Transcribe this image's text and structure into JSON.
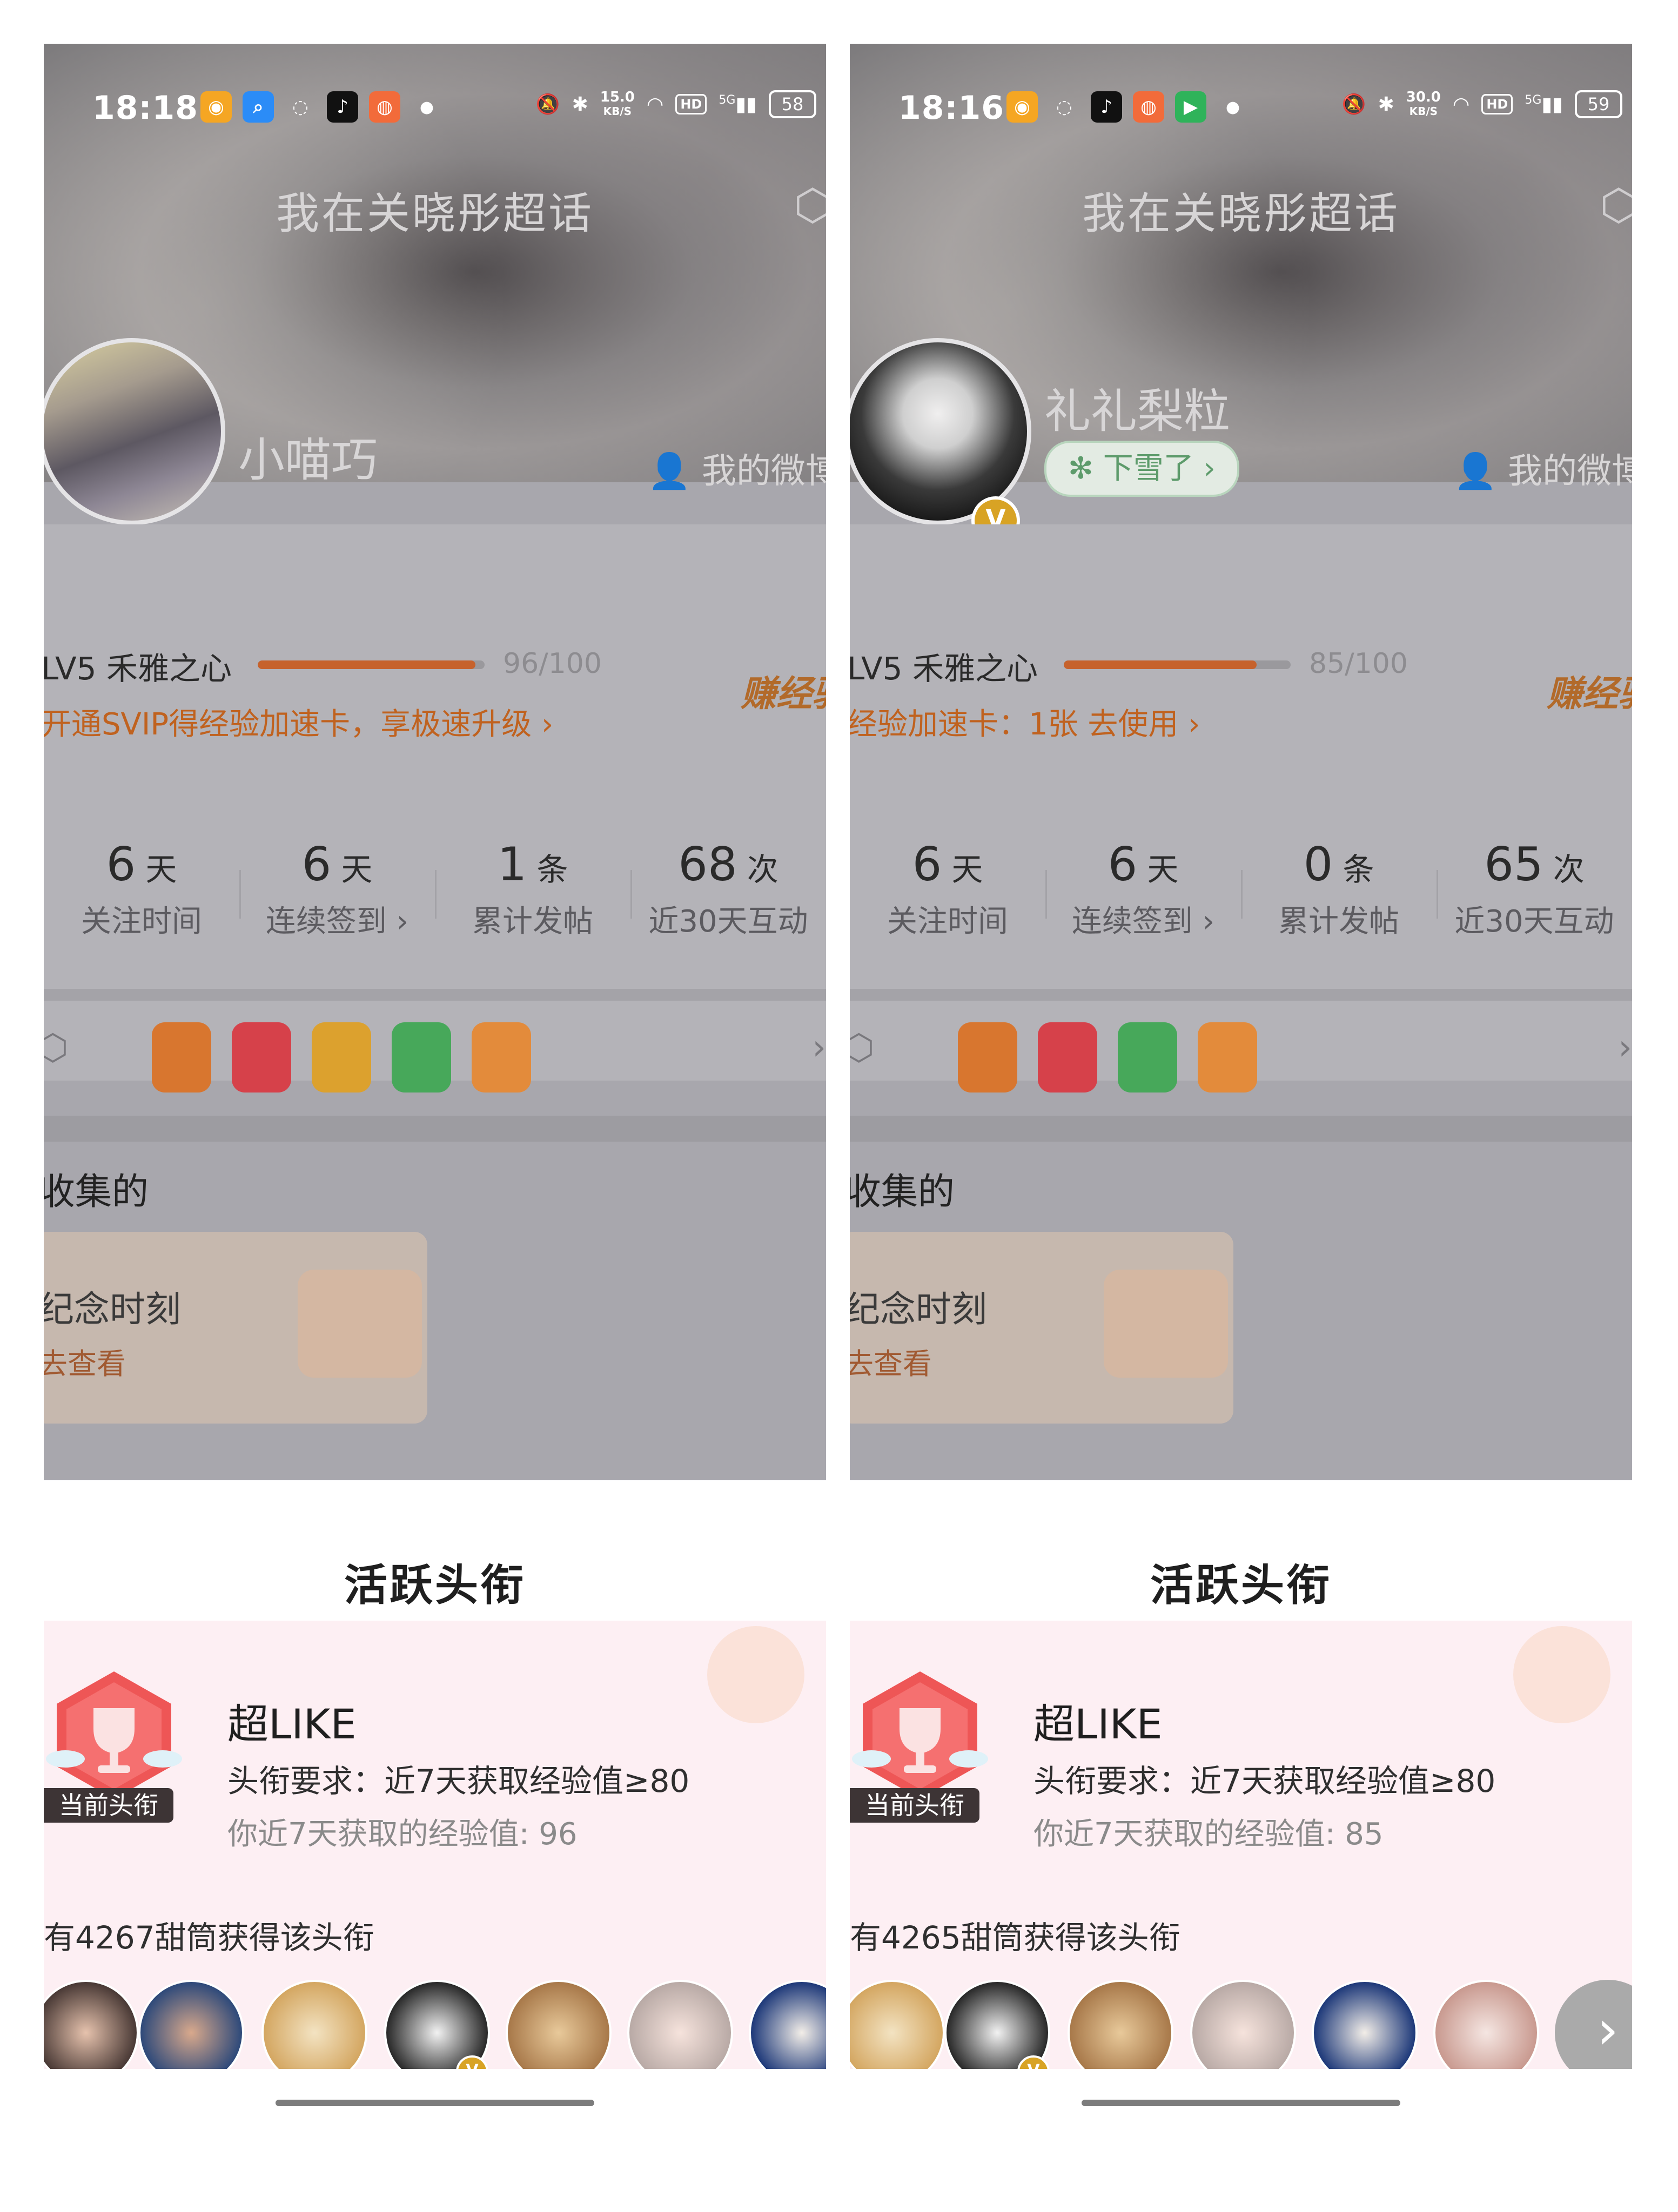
{
  "screens": [
    {
      "status": {
        "time": "18:18",
        "speed_value": "15.0",
        "speed_unit": "KB/S",
        "hd": "HD",
        "network": "5G",
        "battery": "58"
      },
      "page_title": "我在关晓彤超话",
      "user": {
        "name": "小喵巧",
        "status": "",
        "my_weibo": "我的微博"
      },
      "level": {
        "label": "LV5 禾雅之心",
        "progress": 0.96,
        "progress_text": "96/100",
        "promo": "开通SVIP得经验加速卡，享极速升级 ›",
        "earn": "赚经验"
      },
      "stats": [
        {
          "value": "6",
          "unit": "天",
          "label": "关注时间"
        },
        {
          "value": "6",
          "unit": "天",
          "label": "连续签到 ›"
        },
        {
          "value": "1",
          "unit": "条",
          "label": "累计发帖"
        },
        {
          "value": "68",
          "unit": "次",
          "label": "近30天互动"
        }
      ],
      "collection": {
        "title": "收集的",
        "card_title": "纪念时刻",
        "card_sub": "去查看"
      },
      "sheet": {
        "title": "活跃头衔",
        "badge_name": "超LIKE",
        "requirement": "头衔要求：近7天获取经验值≥80",
        "mine": "你近7天获取的经验值: 96",
        "current_tag": "当前头衔",
        "holders": "有4267甜筒获得该头衔"
      }
    },
    {
      "status": {
        "time": "18:16",
        "speed_value": "30.0",
        "speed_unit": "KB/S",
        "hd": "HD",
        "network": "5G",
        "battery": "59"
      },
      "page_title": "我在关晓彤超话",
      "user": {
        "name": "礼礼梨粒",
        "status": "下雪了 ›",
        "my_weibo": "我的微博"
      },
      "level": {
        "label": "LV5 禾雅之心",
        "progress": 0.85,
        "progress_text": "85/100",
        "promo": "经验加速卡：1张 去使用 ›",
        "earn": "赚经验"
      },
      "stats": [
        {
          "value": "6",
          "unit": "天",
          "label": "关注时间"
        },
        {
          "value": "6",
          "unit": "天",
          "label": "连续签到 ›"
        },
        {
          "value": "0",
          "unit": "条",
          "label": "累计发帖"
        },
        {
          "value": "65",
          "unit": "次",
          "label": "近30天互动"
        }
      ],
      "collection": {
        "title": "收集的",
        "card_title": "纪念时刻",
        "card_sub": "去查看"
      },
      "sheet": {
        "title": "活跃头衔",
        "badge_name": "超LIKE",
        "requirement": "头衔要求：近7天获取经验值≥80",
        "mine": "你近7天获取的经验值: 85",
        "current_tag": "当前头衔",
        "holders": "有4265甜筒获得该头衔"
      }
    }
  ],
  "colors": {
    "accent": "#c6622c",
    "promo": "#c0621f",
    "verified": "#d8a324",
    "card_bg": "#fdeff3"
  }
}
